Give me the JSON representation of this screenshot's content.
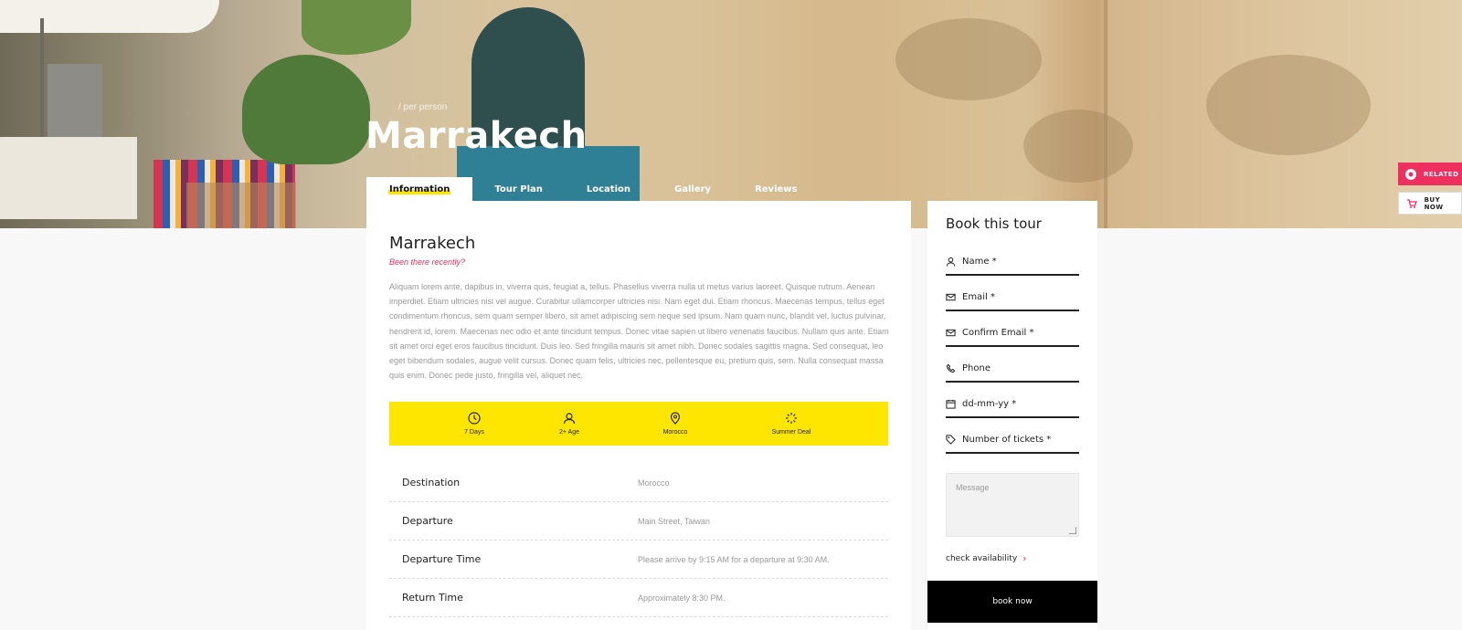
{
  "hero": {
    "per_person": "/ per person",
    "title": "Marrakech"
  },
  "tabs": [
    {
      "label": "Information",
      "active": true
    },
    {
      "label": "Tour Plan",
      "active": false
    },
    {
      "label": "Location",
      "active": false
    },
    {
      "label": "Gallery",
      "active": false
    },
    {
      "label": "Reviews",
      "active": false
    }
  ],
  "side": {
    "related_label": "RELATED",
    "buy_label": "BUY NOW"
  },
  "info": {
    "title": "Marrakech",
    "subtitle": "Been there recently?",
    "description": "Aliquam lorem ante, dapibus in, viverra quis, feugiat a, tellus. Phasellus viverra nulla ut metus varius laoreet. Quisque rutrum. Aenean imperdiet. Etiam ultricies nisi vel augue. Curabitur ullamcorper ultricies nisi. Nam eget dui. Etiam rhoncus. Maecenas tempus, tellus eget condimentum rhoncus, sem quam semper libero, sit amet adipiscing sem neque sed ipsum. Nam quam nunc, blandit vel, luctus pulvinar, hendrerit id, lorem. Maecenas nec odio et ante tincidunt tempus. Donec vitae sapien ut libero venenatis faucibus. Nullam quis ante. Etiam sit amet orci eget eros faucibus tincidunt. Duis leo. Sed fringilla mauris sit amet nibh. Donec sodales sagittis magna. Sed consequat, leo eget bibendum sodales, augue velit cursus. Donec quam felis, ultricies nec, pellentesque eu, pretium quis, sem. Nulla consequat massa quis enim. Donec pede justo, fringilla vel, aliquet nec.",
    "features": [
      {
        "label": "7 Days",
        "icon": "clock-icon"
      },
      {
        "label": "2+ Age",
        "icon": "user-icon"
      },
      {
        "label": "Morocco",
        "icon": "map-pin-icon"
      },
      {
        "label": "Summer Deal",
        "icon": "sun-icon"
      }
    ],
    "rows": [
      {
        "key": "Destination",
        "value": "Morocco"
      },
      {
        "key": "Departure",
        "value": "Main Street, Taiwan"
      },
      {
        "key": "Departure Time",
        "value": "Please arrive by 9:15 AM for a departure at 9:30 AM."
      },
      {
        "key": "Return Time",
        "value": "Approximately 8:30 PM."
      }
    ]
  },
  "booking": {
    "title": "Book this tour",
    "fields": [
      {
        "label": "Name *",
        "icon": "user-icon"
      },
      {
        "label": "Email *",
        "icon": "envelope-icon"
      },
      {
        "label": "Confirm Email *",
        "icon": "envelope-icon"
      },
      {
        "label": "Phone",
        "icon": "phone-icon"
      },
      {
        "label": "dd-mm-yy *",
        "icon": "calendar-icon"
      },
      {
        "label": "Number of tickets *",
        "icon": "tag-icon"
      }
    ],
    "message_placeholder": "Message",
    "check_label": "check availability",
    "book_label": "book now"
  },
  "colors": {
    "accent": "#ef2f60",
    "feature_bar": "#ffe600",
    "book_button": "#000000"
  }
}
